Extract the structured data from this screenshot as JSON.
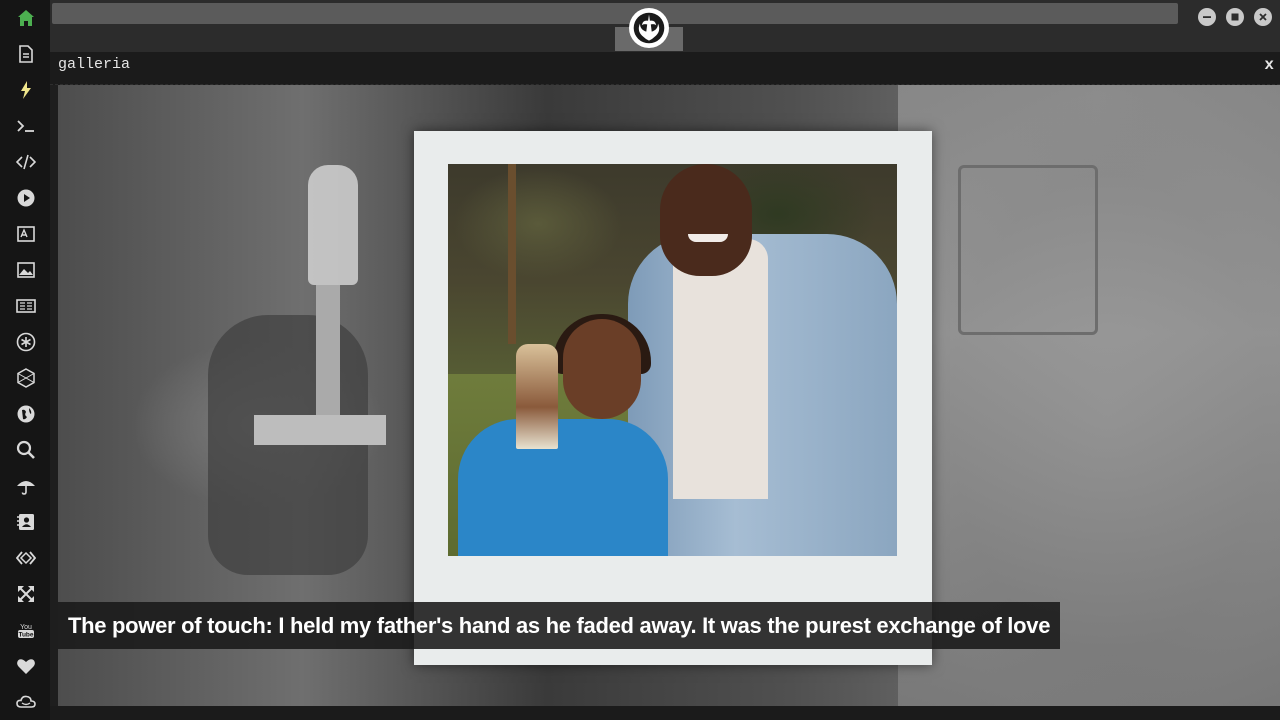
{
  "window": {
    "panel_title": "galleria",
    "panel_close": "x"
  },
  "gallery": {
    "caption": "The power of touch: I held my father's hand as he faded away. It was the purest exchange of love"
  },
  "sidebar": {
    "items": [
      {
        "icon": "home-icon",
        "active": true
      },
      {
        "icon": "document-icon"
      },
      {
        "icon": "lightning-icon"
      },
      {
        "icon": "terminal-icon"
      },
      {
        "icon": "code-icon"
      },
      {
        "icon": "play-icon"
      },
      {
        "icon": "translate-icon"
      },
      {
        "icon": "image-icon"
      },
      {
        "icon": "news-icon"
      },
      {
        "icon": "asterisk-icon"
      },
      {
        "icon": "hexagon-icon"
      },
      {
        "icon": "globe-icon"
      },
      {
        "icon": "search-icon"
      },
      {
        "icon": "umbrella-icon"
      },
      {
        "icon": "contact-icon"
      },
      {
        "icon": "dev-icon"
      },
      {
        "icon": "expand-icon"
      },
      {
        "icon": "youtube-icon"
      },
      {
        "icon": "heart-icon"
      },
      {
        "icon": "cloud-icon"
      }
    ]
  },
  "colors": {
    "accent": "#4caf50",
    "icon": "#d9d9d9",
    "sidebar_bg": "#151515",
    "topbar_bg": "#2c2c2c"
  }
}
